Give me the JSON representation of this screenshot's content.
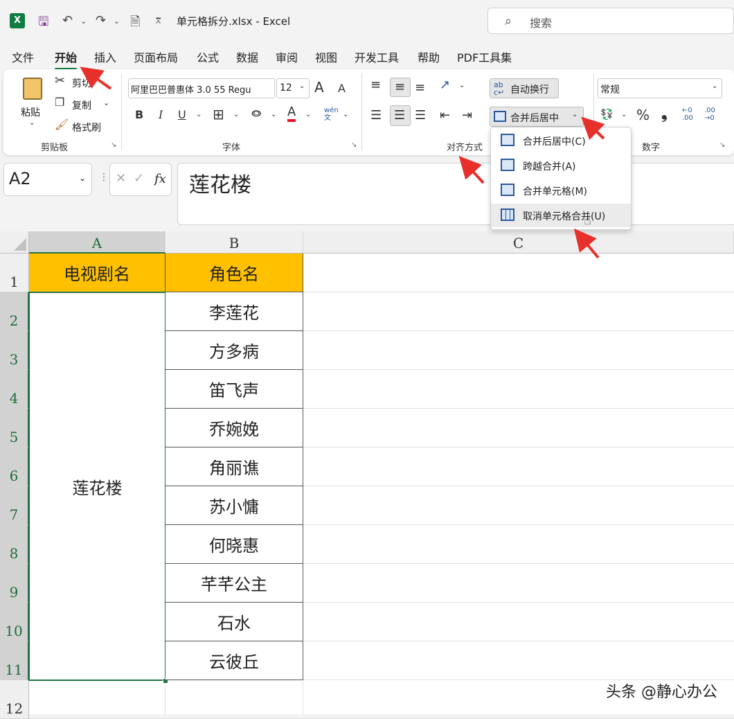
{
  "titlebar": {
    "app_icon": "excel-icon",
    "doc_title": "单元格拆分.xlsx  -  Excel",
    "search_placeholder": "搜索"
  },
  "tabs": [
    "文件",
    "开始",
    "插入",
    "页面布局",
    "公式",
    "数据",
    "审阅",
    "视图",
    "开发工具",
    "帮助",
    "PDF工具集"
  ],
  "active_tab": "开始",
  "ribbon": {
    "clipboard": {
      "paste": "粘贴",
      "cut": "剪切",
      "copy": "复制",
      "format_painter": "格式刷",
      "label": "剪贴板"
    },
    "font": {
      "name": "阿里巴巴普惠体 3.0 55 Regu",
      "size": "12",
      "bold": "B",
      "italic": "I",
      "underline": "U",
      "grow": "A",
      "shrink": "A",
      "phonetic": "wén文",
      "label": "字体"
    },
    "alignment": {
      "wrap_text": "自动换行",
      "merge_center": "合并后居中",
      "label": "对齐方式"
    },
    "number": {
      "format": "常规",
      "percent": "%",
      "comma": "❟",
      "inc_decimal": "←0 .00",
      "dec_decimal": ".00 →0",
      "label": "数字"
    }
  },
  "formula_bar": {
    "name_box": "A2",
    "fx": "fx",
    "value": "莲花楼"
  },
  "merge_menu": {
    "items": [
      {
        "label": "合并后居中(C)"
      },
      {
        "label": "跨越合并(A)"
      },
      {
        "label": "合并单元格(M)"
      },
      {
        "label": "取消单元格合并(U)"
      }
    ]
  },
  "sheet": {
    "columns": [
      "A",
      "B",
      "C"
    ],
    "rows": [
      "1",
      "2",
      "3",
      "4",
      "5",
      "6",
      "7",
      "8",
      "9",
      "10",
      "11",
      "12"
    ],
    "header": {
      "a": "电视剧名",
      "b": "角色名"
    },
    "merged_a": "莲花楼",
    "col_b": [
      "李莲花",
      "方多病",
      "笛飞声",
      "乔婉娩",
      "角丽谯",
      "苏小慵",
      "何晓惠",
      "芊芊公主",
      "石水",
      "云彼丘"
    ],
    "header_fill": "#ffc000",
    "selection_color": "#217346"
  },
  "watermark": "头条 @静心办公"
}
